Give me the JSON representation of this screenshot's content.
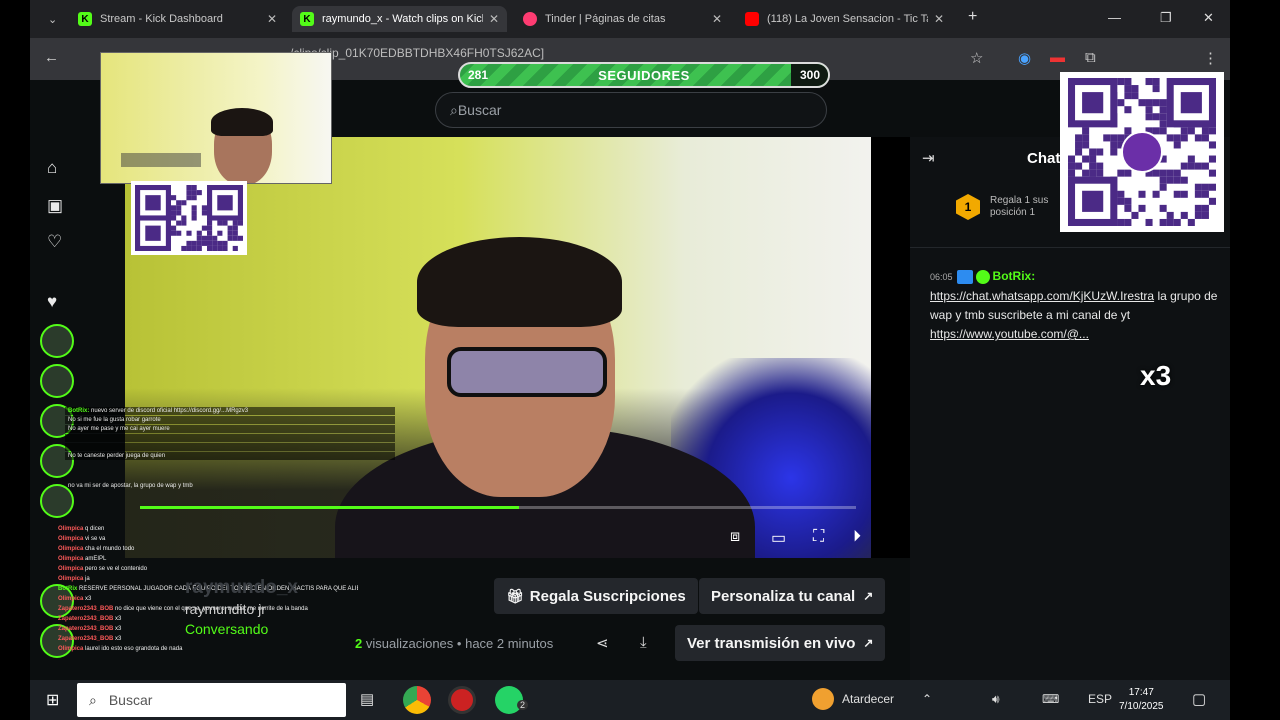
{
  "browser": {
    "tabs": [
      {
        "title": "Stream - Kick Dashboard",
        "icon": "kick-icon"
      },
      {
        "title": "raymundo_x - Watch clips on Kick",
        "icon": "kick-icon"
      },
      {
        "title": "Tinder | Páginas de citas",
        "icon": "tinder-icon"
      },
      {
        "title": "(118) La Joven Sensacion - Tic Tac",
        "icon": "youtube-icon"
      }
    ],
    "new_tab": "+",
    "url": "/clips/clip_01K70EDBBTDHBX46FH0TSJ62AC]"
  },
  "followers_goal": {
    "current": "281",
    "label": "SEGUIDORES",
    "goal": "300",
    "fraction": 0.9
  },
  "search": {
    "placeholder": "Buscar"
  },
  "video": {
    "progress_fraction": 0.53,
    "overlay_lines": [
      {
        "user": "BotRix:",
        "text": "nuevo server de discord oficial https://discord.gg/...MRgzv3"
      },
      {
        "user": "",
        "text": "No si me fue la gusta robar garrote"
      },
      {
        "user": "",
        "text": "No ayer me pase y me cai ayer muere"
      },
      {
        "user": "",
        "text": ""
      },
      {
        "user": "",
        "text": "No te caneste perder juega de quien"
      },
      {
        "user": "",
        "text": ""
      },
      {
        "user": "",
        "text": "no va mi ser de apostar, la grupo de wap y tmb"
      }
    ]
  },
  "stream_overlay_chat": [
    {
      "user": "Olimpica",
      "text": "q dicen"
    },
    {
      "user": "Olimpica",
      "text": "vi se va"
    },
    {
      "user": "Olimpica",
      "text": "cha el mundo todo"
    },
    {
      "user": "Olimpica",
      "text": "amEIPL"
    },
    {
      "user": "Olimpica",
      "text": "pero se ve el contenido"
    },
    {
      "user": "Olimpica",
      "text": "ja"
    },
    {
      "user": "BotRix",
      "text": "RESERVE PERSONAL JUGADOR CADA EQUIPO DEL TORNEO EN ORDEN ISACTIS PARA QUE ALIENTES A SU EQUIPO FAVORITO"
    },
    {
      "user": "Olimpica",
      "text": "x3"
    },
    {
      "user": "Zapatero2343_BOB",
      "text": "no dice que viene con el que se, yo mero, queda, me derrite de la banda"
    },
    {
      "user": "Zapatero2343_BOB",
      "text": "x3"
    },
    {
      "user": "Zapatero2343_BOB",
      "text": "x3"
    },
    {
      "user": "Zapatero2343_BOB",
      "text": "x3"
    },
    {
      "user": "Olimpica",
      "text": "laurel ido esto eso grandota de nada"
    }
  ],
  "channel": {
    "name": "raymundo_x",
    "subtitle": "raymundito jr",
    "category": "Conversando"
  },
  "buttons": {
    "gift_subs": "Regala Suscripciones",
    "customize": "Personaliza tu canal",
    "watch_live": "Ver transmisión en vivo"
  },
  "views": {
    "count": "2",
    "label": "visualizaciones",
    "time": "• hace 2 minutos"
  },
  "chat": {
    "title": "Chat",
    "gift_rank": "1",
    "gift_text_1": "Regala 1 sus",
    "gift_text_2": "posición 1",
    "message": {
      "time": "06:05",
      "user": "BotRix:",
      "link1": "https://chat.whatsapp.com/KjKUzW.Irestra",
      "text": "la grupo de wap y tmb suscribete a mi canal de yt",
      "link2": "https://www.youtube.com/@..."
    },
    "sticker_text": "x3"
  },
  "taskbar": {
    "search": "Buscar",
    "weather": "Atardecer",
    "lang": "ESP",
    "time": "17:47",
    "date": "7/10/2025",
    "whatsapp_badge": "2"
  },
  "colors": {
    "kick_green": "#53fc18",
    "bg": "#0b0e0f",
    "button": "#24272c"
  }
}
